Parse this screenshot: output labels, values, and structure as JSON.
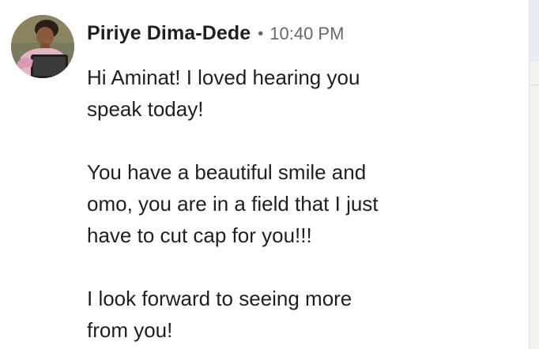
{
  "message": {
    "sender_name": "Piriye Dima-Dede",
    "separator": "•",
    "timestamp": "10:40 PM",
    "paragraphs": [
      [
        "Hi Aminat! I loved hearing you",
        "speak today!"
      ],
      [
        "You have a beautiful smile and",
        "omo, you are in a field that I just",
        "have to cut cap for you!!!"
      ],
      [
        "I look forward to seeing more",
        "from you!"
      ]
    ],
    "avatar_icon": "profile-photo"
  }
}
